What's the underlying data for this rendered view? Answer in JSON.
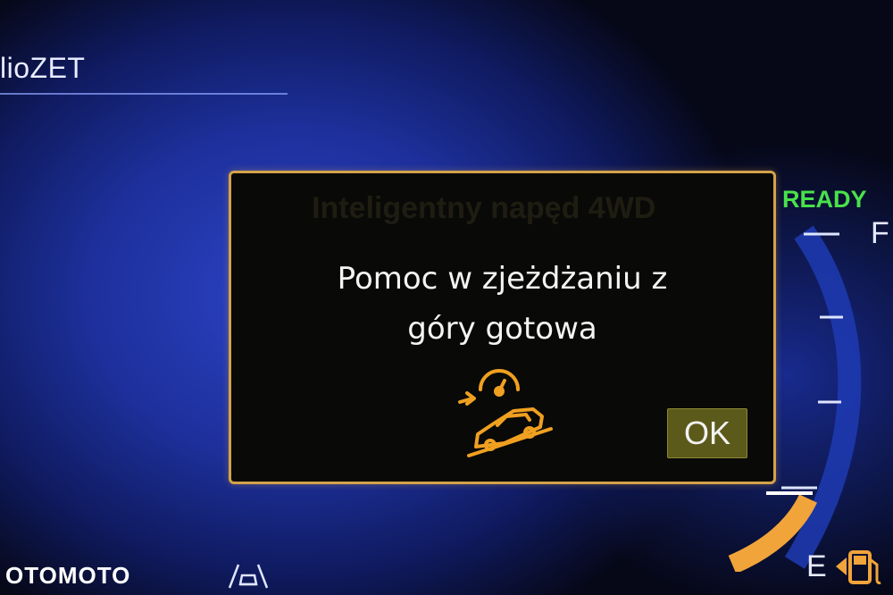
{
  "header": {
    "station_label": "lioZET"
  },
  "gauge": {
    "ready_label": "READY",
    "full_label": "F",
    "empty_label": "E",
    "fuel_icon": "fuel-pump-icon",
    "colors": {
      "ready": "#49e14b",
      "fuel_fill": "#f0a43a",
      "scale": "#3b5bd8"
    }
  },
  "dialog": {
    "background_title": "Inteligentny napęd 4WD",
    "message_line1": "Pomoc w zjeżdżaniu z",
    "message_line2": "góry gotowa",
    "icon": "hill-descent-control-icon",
    "ok_label": "OK",
    "colors": {
      "border": "#d3a24a",
      "icon": "#f0a020"
    }
  },
  "status_icons": {
    "lane_assist": "lane-keeping-icon"
  },
  "watermark": {
    "text": "OTOMOTO"
  }
}
